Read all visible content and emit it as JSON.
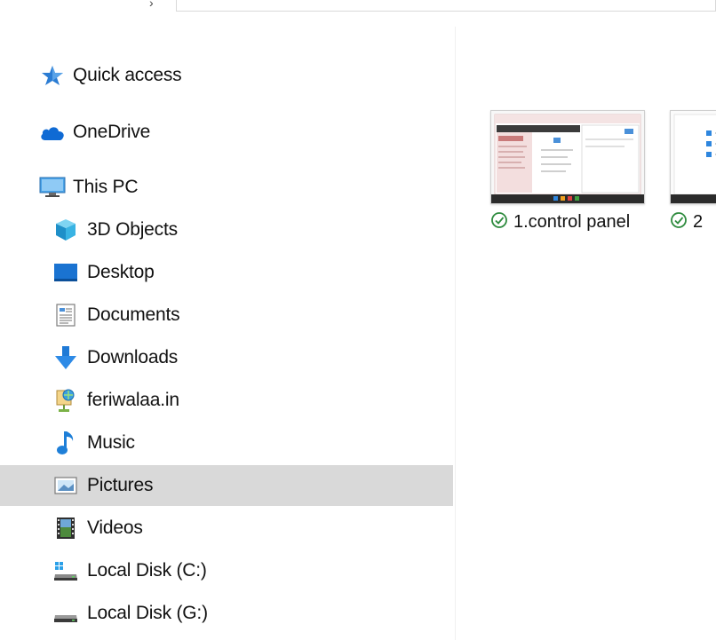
{
  "sidebar": {
    "items": [
      {
        "label": "Quick access",
        "icon": "star-icon"
      },
      {
        "label": "OneDrive",
        "icon": "cloud-icon"
      },
      {
        "label": "This PC",
        "icon": "monitor-icon"
      },
      {
        "label": "3D Objects",
        "icon": "cube-icon"
      },
      {
        "label": "Desktop",
        "icon": "desktop-icon"
      },
      {
        "label": "Documents",
        "icon": "document-icon"
      },
      {
        "label": "Downloads",
        "icon": "download-arrow-icon"
      },
      {
        "label": "feriwalaa.in",
        "icon": "network-location-icon"
      },
      {
        "label": "Music",
        "icon": "music-note-icon"
      },
      {
        "label": "Pictures",
        "icon": "pictures-icon"
      },
      {
        "label": "Videos",
        "icon": "film-icon"
      },
      {
        "label": "Local Disk (C:)",
        "icon": "system-drive-icon"
      },
      {
        "label": "Local Disk (G:)",
        "icon": "drive-icon"
      }
    ],
    "selected": "Pictures"
  },
  "content": {
    "files": [
      {
        "name": "1.control panel",
        "status": "synced"
      },
      {
        "name": "2",
        "status": "synced"
      }
    ]
  },
  "colors": {
    "selection": "#d9d9d9",
    "synced_green": "#2e8b3e",
    "accent_blue": "#0078d7"
  }
}
